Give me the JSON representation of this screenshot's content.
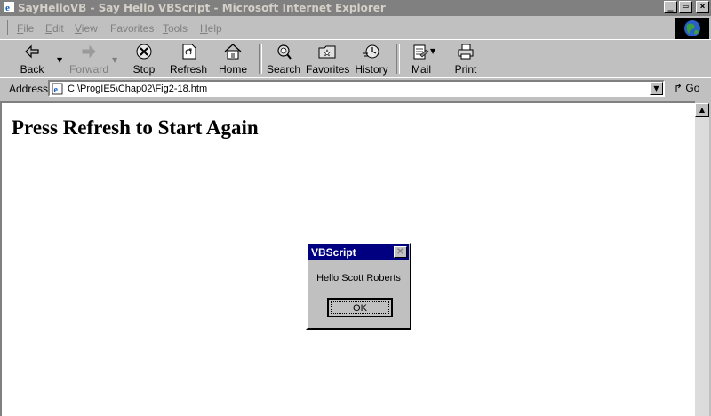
{
  "window": {
    "title": "SayHelloVB - Say Hello VBScript - Microsoft Internet Explorer",
    "buttons": {
      "minimize": "_",
      "maximize": "▭",
      "close": "×"
    }
  },
  "menu": [
    {
      "first": "F",
      "rest": "ile"
    },
    {
      "first": "E",
      "rest": "dit"
    },
    {
      "first": "V",
      "rest": "iew"
    },
    {
      "first": "",
      "rest": "Favorites"
    },
    {
      "first": "T",
      "rest": "ools"
    },
    {
      "first": "H",
      "rest": "elp"
    }
  ],
  "toolbar": {
    "back": "Back",
    "forward": "Forward",
    "stop": "Stop",
    "refresh": "Refresh",
    "home": "Home",
    "search": "Search",
    "favorites": "Favorites",
    "history": "History",
    "mail": "Mail",
    "print": "Print"
  },
  "address": {
    "label": "Address",
    "value": "C:\\ProgIE5\\Chap02\\Fig2-18.htm",
    "go": "Go"
  },
  "page": {
    "heading": "Press Refresh to Start Again"
  },
  "dialog": {
    "title": "VBScript",
    "message": "Hello Scott Roberts",
    "ok": "OK"
  },
  "colors": {
    "titlebar_inactive": "#808080",
    "dialog_title": "#000080",
    "chrome": "#c0c0c0"
  }
}
